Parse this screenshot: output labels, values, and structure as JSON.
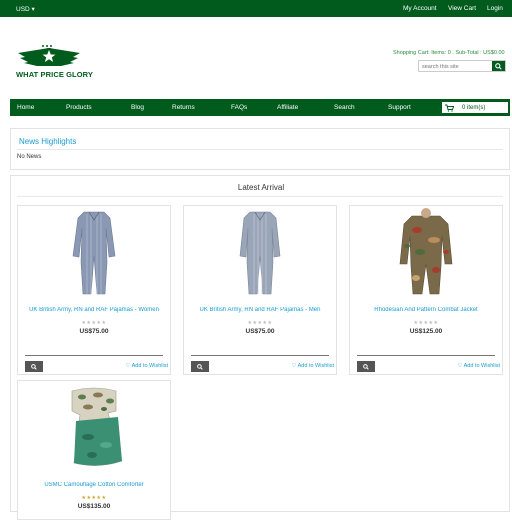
{
  "topbar": {
    "currency": "USD",
    "links": [
      "My Account",
      "View Cart",
      "Login"
    ]
  },
  "brand": {
    "name": "WHAT PRICE GLORY",
    "color": "#005b1c"
  },
  "header": {
    "cart_info": "Shopping Cart: Items: 0 . Sub-Total : US$0.00",
    "search_placeholder": "search this site"
  },
  "nav": {
    "items": [
      "Home",
      "Products",
      "Blog",
      "Returns",
      "FAQs",
      "Affiliate",
      "Search",
      "Support"
    ],
    "cart_label": "0 item(s)"
  },
  "news": {
    "title": "News Highlights",
    "body": "No News"
  },
  "latest": {
    "title": "Latest Arrival",
    "wishlist_label": "Add to Wishlist",
    "products": [
      {
        "name": "UK British Army, RN and RAF Pajamas - Women",
        "price": "US$75.00",
        "rating": 0
      },
      {
        "name": "UK British Army, RN and RAF Pajamas - Men",
        "price": "US$75.00",
        "rating": 0
      },
      {
        "name": "Rhodesian And Pattern Combat Jacket",
        "price": "US$125.00",
        "rating": 0
      },
      {
        "name": "USMC Camouflage Cotton Comforter",
        "price": "US$135.00",
        "rating": 5
      }
    ]
  },
  "colors": {
    "accent": "#005b1c",
    "link": "#1a9bd1"
  }
}
